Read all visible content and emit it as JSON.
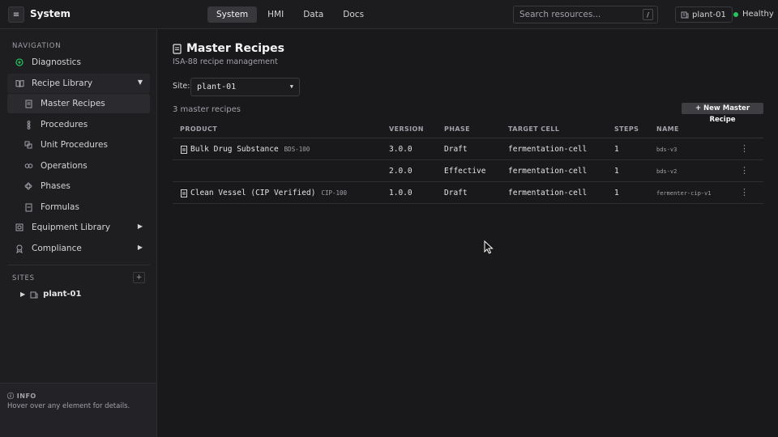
{
  "topbar": {
    "menu_icon": "hamburger-icon",
    "app_title": "System",
    "tabs": [
      {
        "label": "System",
        "active": true
      },
      {
        "label": "HMI",
        "active": false
      },
      {
        "label": "Data",
        "active": false
      },
      {
        "label": "Docs",
        "active": false
      }
    ],
    "search": {
      "placeholder": "Search resources...",
      "shortcut": "/"
    },
    "site": "plant-01",
    "health": {
      "label": "Healthy",
      "color": "#22c55e"
    }
  },
  "sidebar": {
    "nav_label": "NAVIGATION",
    "items": [
      {
        "label": "Diagnostics",
        "icon": "target-icon"
      },
      {
        "label": "Recipe Library",
        "icon": "book-icon",
        "expanded": true
      },
      {
        "label": "Master Recipes",
        "icon": "document-icon",
        "selected": true
      },
      {
        "label": "Procedures",
        "icon": "flow-icon"
      },
      {
        "label": "Unit Procedures",
        "icon": "layers-icon"
      },
      {
        "label": "Operations",
        "icon": "gears-icon"
      },
      {
        "label": "Phases",
        "icon": "atom-icon"
      },
      {
        "label": "Formulas",
        "icon": "formula-icon"
      },
      {
        "label": "Equipment Library",
        "icon": "equipment-icon"
      },
      {
        "label": "Compliance",
        "icon": "badge-icon"
      }
    ],
    "sites_label": "SITES",
    "add_label": "+",
    "sites": [
      {
        "label": "plant-01"
      }
    ],
    "info": {
      "title": "INFO",
      "text": "Hover over any element for details."
    }
  },
  "main": {
    "title": "Master Recipes",
    "subtitle": "ISA-88 recipe management",
    "site_label": "Site:",
    "site_value": "plant-01",
    "count_text": "3 master recipes",
    "new_button": "+ New Master Recipe",
    "columns": [
      "PRODUCT",
      "VERSION",
      "PHASE",
      "TARGET CELL",
      "STEPS",
      "NAME"
    ],
    "rows": [
      {
        "product": "Bulk Drug Substance",
        "code": "BDS-100",
        "version": "3.0.0",
        "phase": "Draft",
        "cell": "fermentation-cell",
        "steps": "1",
        "name": "bds-v3",
        "has_icon": true
      },
      {
        "product": "",
        "code": "",
        "version": "2.0.0",
        "phase": "Effective",
        "cell": "fermentation-cell",
        "steps": "1",
        "name": "bds-v2",
        "has_icon": false
      },
      {
        "product": "Clean Vessel (CIP Verified)",
        "code": "CIP-100",
        "version": "1.0.0",
        "phase": "Draft",
        "cell": "fermentation-cell",
        "steps": "1",
        "name": "fermenter-cip-v1",
        "has_icon": true
      }
    ],
    "row_menu": "⋮"
  }
}
